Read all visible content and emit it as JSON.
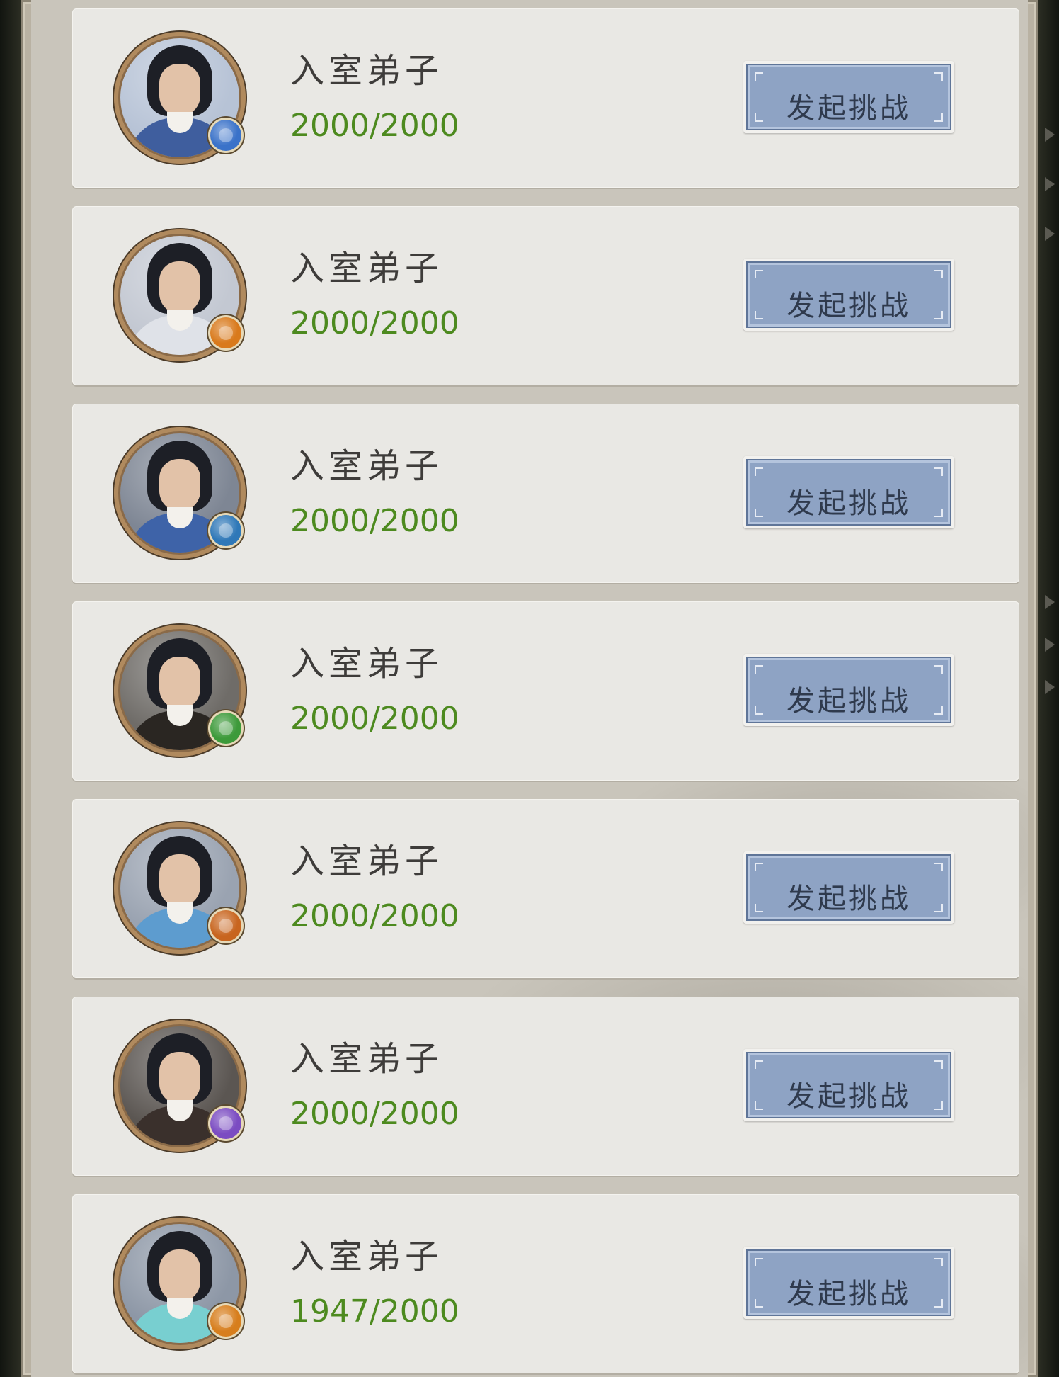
{
  "icons": {
    "badge_left_frame": "chevron-icon"
  },
  "colors": {
    "card_bg": "#e9e8e4",
    "hp_text": "#4d8a1f",
    "button_fill": "#8ea3c4",
    "title_text": "#3e3c3a"
  },
  "disciples": [
    {
      "title": "入室弟子",
      "hp": "2000/2000",
      "button_label": "发起挑战",
      "robe": "#3f5e9e",
      "bg": "#b7c3d6",
      "badge": "#3a72c9",
      "badge_icon": "water-skill-icon"
    },
    {
      "title": "入室弟子",
      "hp": "2000/2000",
      "button_label": "发起挑战",
      "robe": "#dfe2e8",
      "bg": "#c3c8d2",
      "badge": "#d97a1c",
      "badge_icon": "fire-skill-icon"
    },
    {
      "title": "入室弟子",
      "hp": "2000/2000",
      "button_label": "发起挑战",
      "robe": "#3e63a8",
      "bg": "#7e8694",
      "badge": "#2f78b8",
      "badge_icon": "sword-skill-icon"
    },
    {
      "title": "入室弟子",
      "hp": "2000/2000",
      "button_label": "发起挑战",
      "robe": "#2a2622",
      "bg": "#6f6c68",
      "badge": "#3d9a3a",
      "badge_icon": "poison-skill-icon"
    },
    {
      "title": "入室弟子",
      "hp": "2000/2000",
      "button_label": "发起挑战",
      "robe": "#5d9ccf",
      "bg": "#9aa3b1",
      "badge": "#c8651f",
      "badge_icon": "blade-skill-icon"
    },
    {
      "title": "入室弟子",
      "hp": "2000/2000",
      "button_label": "发起挑战",
      "robe": "#3a302c",
      "bg": "#5b5652",
      "badge": "#7b4cc2",
      "badge_icon": "arcane-skill-icon"
    },
    {
      "title": "入室弟子",
      "hp": "1947/2000",
      "button_label": "发起挑战",
      "robe": "#78cfd0",
      "bg": "#8d97a6",
      "badge": "#d77e1d",
      "badge_icon": "fire-skill-icon"
    }
  ]
}
